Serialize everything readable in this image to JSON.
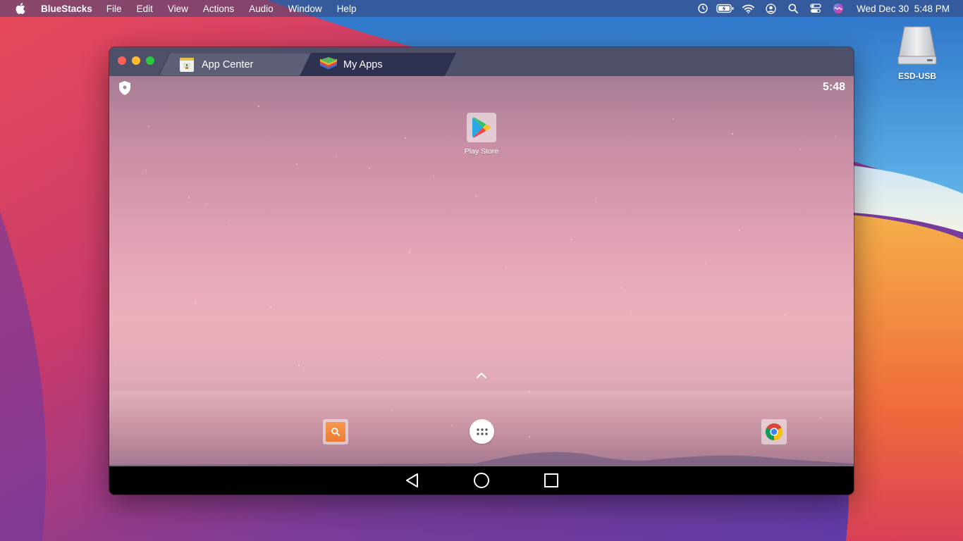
{
  "menubar": {
    "app_name": "BlueStacks",
    "menus": [
      "File",
      "Edit",
      "View",
      "Actions",
      "Audio",
      "Window",
      "Help"
    ],
    "status_icons": [
      "time-machine-icon",
      "battery-charging-icon",
      "wifi-icon",
      "user-icon",
      "spotlight-search-icon",
      "control-center-icon",
      "siri-icon"
    ],
    "clock": "Wed Dec 30  5:48 PM"
  },
  "desktop": {
    "drive_label": "ESD-USB"
  },
  "window": {
    "tabs": [
      {
        "label": "App Center",
        "icon": "app-center-icon",
        "active": false
      },
      {
        "label": "My Apps",
        "icon": "bluestacks-layers-icon",
        "active": true
      }
    ]
  },
  "android": {
    "status_time": "5:48",
    "home_apps": [
      {
        "label": "Play Store",
        "icon": "play-store-icon"
      }
    ],
    "dock_apps": [
      "search-app-icon",
      "app-drawer-icon",
      "chrome-icon"
    ],
    "nav_buttons": [
      "back-icon",
      "home-icon",
      "recents-icon"
    ]
  },
  "colors": {
    "titlebar": "#4d5068",
    "active_tab": "#2e3150",
    "inactive_tab": "#5c5f76",
    "navbar": "#000000"
  }
}
